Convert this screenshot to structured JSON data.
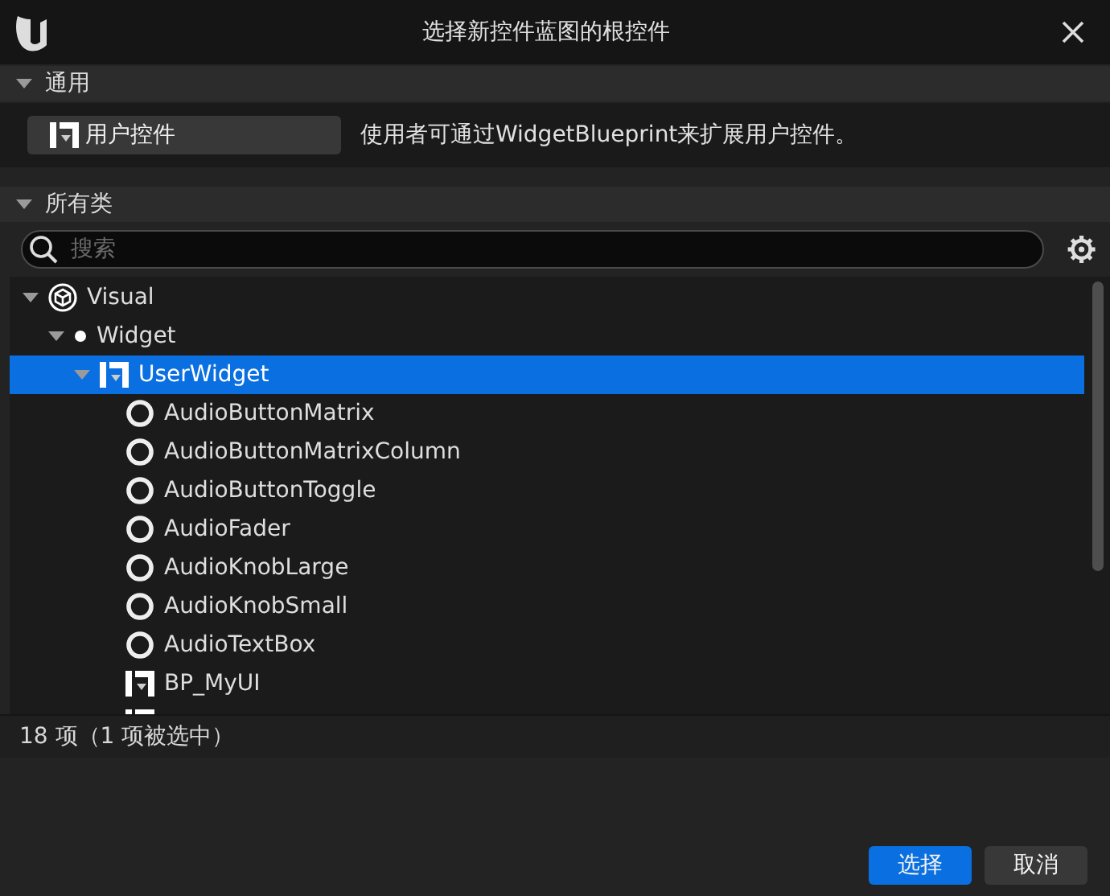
{
  "window": {
    "title": "选择新控件蓝图的根控件"
  },
  "common_section": {
    "title": "通用",
    "expanded": true,
    "items": [
      {
        "label": "用户控件",
        "description": "使用者可通过WidgetBlueprint来扩展用户控件。"
      }
    ]
  },
  "all_classes_section": {
    "title": "所有类",
    "expanded": true
  },
  "search": {
    "placeholder": "搜索"
  },
  "tree": [
    {
      "label": "Visual",
      "kind": "visual",
      "expanded": true,
      "selected": false,
      "children": [
        {
          "label": "Widget",
          "kind": "dot",
          "expanded": true,
          "selected": false,
          "children": [
            {
              "label": "UserWidget",
              "kind": "blueprint",
              "expanded": true,
              "selected": true,
              "children": [
                {
                  "label": "AudioButtonMatrix",
                  "kind": "ring",
                  "selected": false
                },
                {
                  "label": "AudioButtonMatrixColumn",
                  "kind": "ring",
                  "selected": false
                },
                {
                  "label": "AudioButtonToggle",
                  "kind": "ring",
                  "selected": false
                },
                {
                  "label": "AudioFader",
                  "kind": "ring",
                  "selected": false
                },
                {
                  "label": "AudioKnobLarge",
                  "kind": "ring",
                  "selected": false
                },
                {
                  "label": "AudioKnobSmall",
                  "kind": "ring",
                  "selected": false
                },
                {
                  "label": "AudioTextBox",
                  "kind": "ring",
                  "selected": false
                },
                {
                  "label": "BP_MyUI",
                  "kind": "blueprint",
                  "selected": false
                },
                {
                  "kind": "blueprint",
                  "selected": false
                }
              ]
            }
          ]
        }
      ]
    }
  ],
  "status_bar": {
    "text": "18 项（1 项被选中）"
  },
  "buttons": [
    {
      "label": "选择",
      "kind": "primary"
    },
    {
      "label": "取消",
      "kind": "secondary"
    }
  ]
}
